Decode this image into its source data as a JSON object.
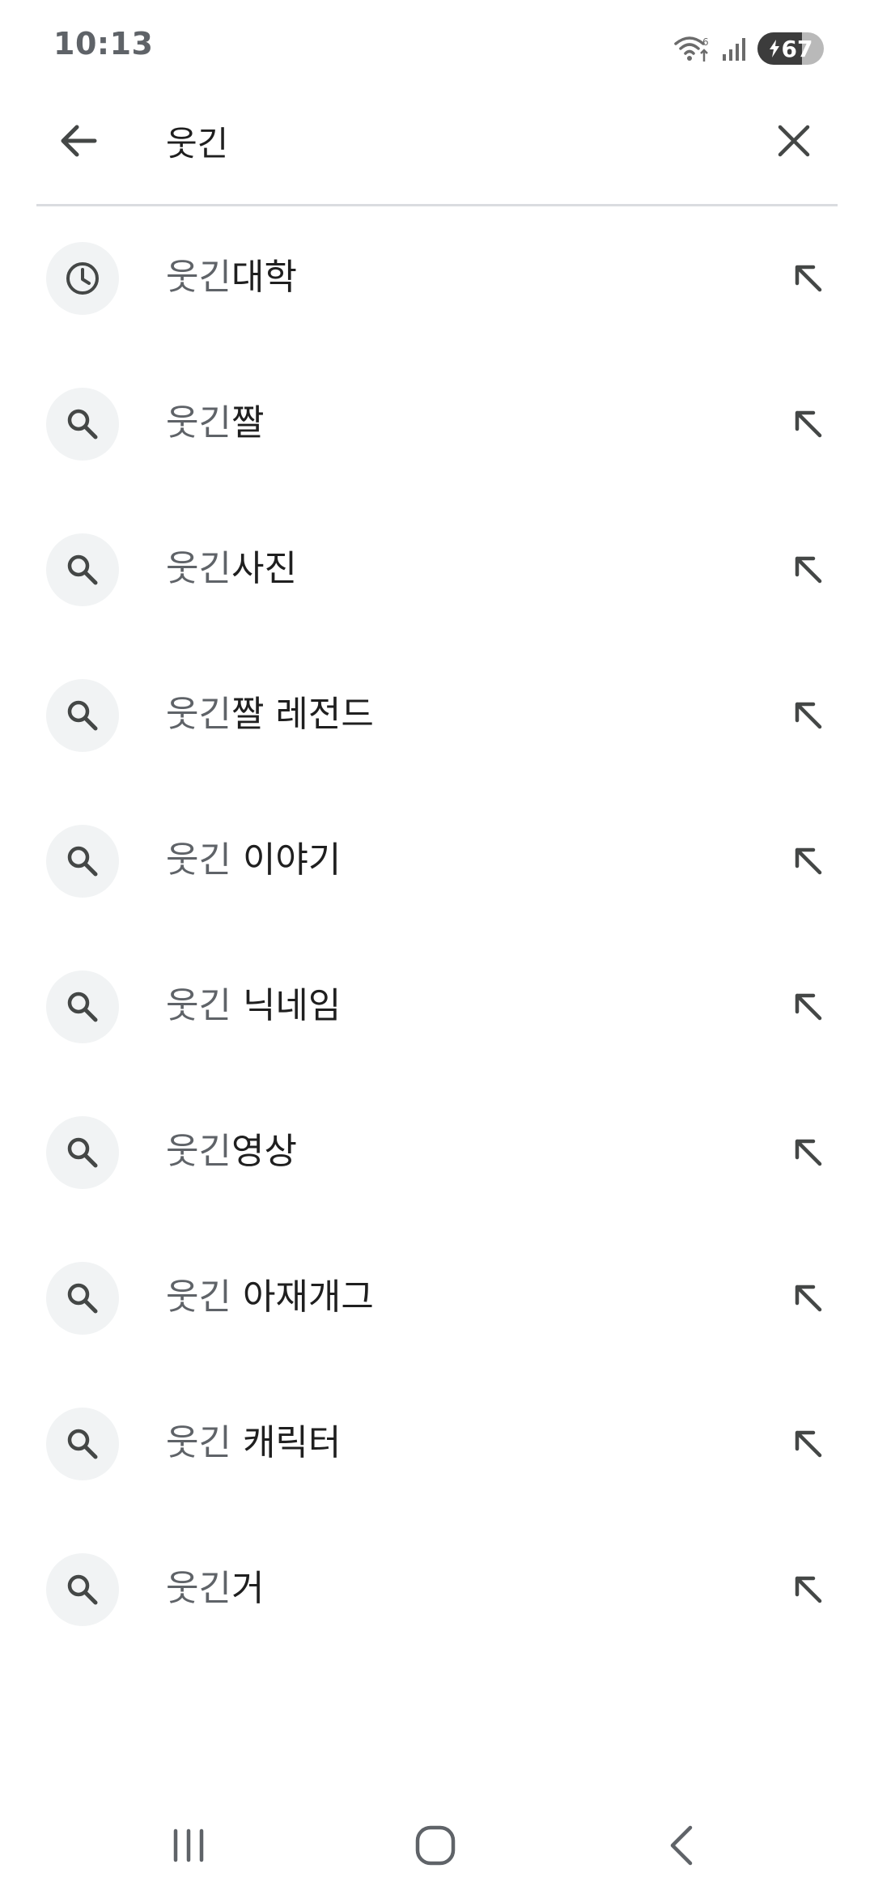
{
  "status_bar": {
    "time": "10:13",
    "battery_level": "67",
    "battery_fraction": 0.67,
    "icons": [
      "wifi-icon",
      "signal-icon",
      "battery-charging-icon"
    ]
  },
  "search": {
    "query": "웃긴",
    "back_icon": "arrow-left-icon",
    "clear_icon": "close-icon"
  },
  "suggestions": [
    {
      "icon": "history-icon",
      "match": "웃긴",
      "rest": "대학"
    },
    {
      "icon": "search-icon",
      "match": "웃긴",
      "rest": "짤"
    },
    {
      "icon": "search-icon",
      "match": "웃긴",
      "rest": "사진"
    },
    {
      "icon": "search-icon",
      "match": "웃긴",
      "rest": "짤 레전드"
    },
    {
      "icon": "search-icon",
      "match": "웃긴",
      "rest": " 이야기"
    },
    {
      "icon": "search-icon",
      "match": "웃긴",
      "rest": " 닉네임"
    },
    {
      "icon": "search-icon",
      "match": "웃긴",
      "rest": "영상"
    },
    {
      "icon": "search-icon",
      "match": "웃긴",
      "rest": " 아재개그"
    },
    {
      "icon": "search-icon",
      "match": "웃긴",
      "rest": " 캐릭터"
    },
    {
      "icon": "search-icon",
      "match": "웃긴",
      "rest": "거"
    }
  ],
  "nav_bar": {
    "icons": [
      "recent-apps-icon",
      "home-icon",
      "back-icon"
    ]
  },
  "colors": {
    "text_primary": "#1f1f1f",
    "text_secondary": "#5f6368",
    "icon_circle_bg": "#f1f3f4",
    "divider": "#dadce0"
  }
}
